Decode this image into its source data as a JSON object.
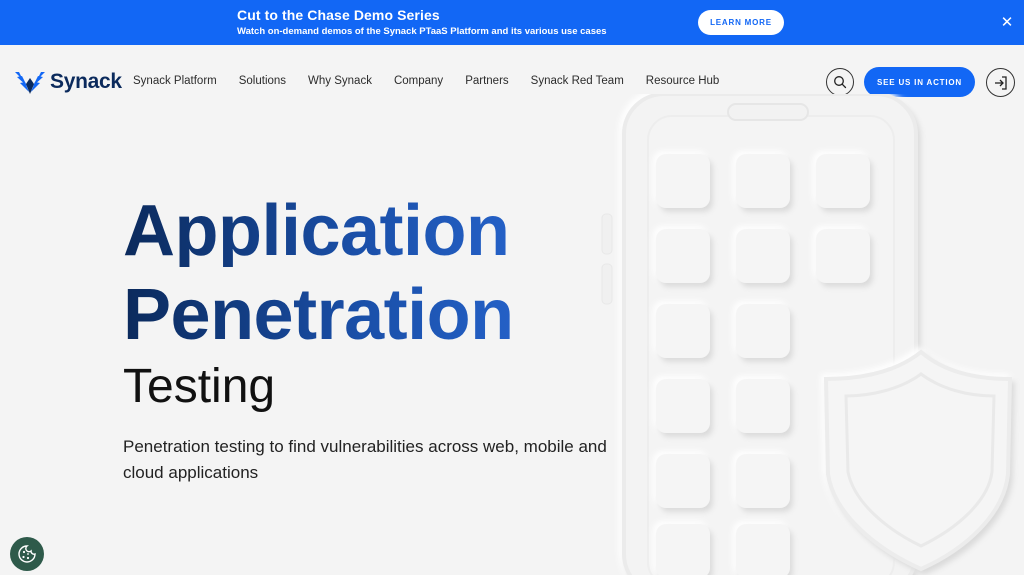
{
  "banner": {
    "title": "Cut to the Chase Demo Series",
    "subtitle": "Watch on-demand demos of the Synack PTaaS Platform and its various use cases",
    "button_label": "LEARN MORE",
    "close_glyph": "✕"
  },
  "nav": {
    "logo_text": "Synack",
    "links": [
      "Synack Platform",
      "Solutions",
      "Why Synack",
      "Company",
      "Partners",
      "Synack Red Team",
      "Resource Hub"
    ],
    "cta_label": "SEE US IN ACTION"
  },
  "hero": {
    "line1": "Application",
    "line2": "Penetration",
    "line3": "Testing",
    "description": "Penetration testing to find vulnerabilities across web, mobile and cloud applications"
  },
  "colors": {
    "primary": "#1267f5",
    "navy": "#0b2a5c",
    "background": "#f4f4f4",
    "cookie": "#2e5a4a"
  },
  "icons": {
    "logo": "synack-wing-icon",
    "search": "search-icon",
    "login": "login-icon",
    "close": "close-icon",
    "cookie": "cookie-icon"
  }
}
